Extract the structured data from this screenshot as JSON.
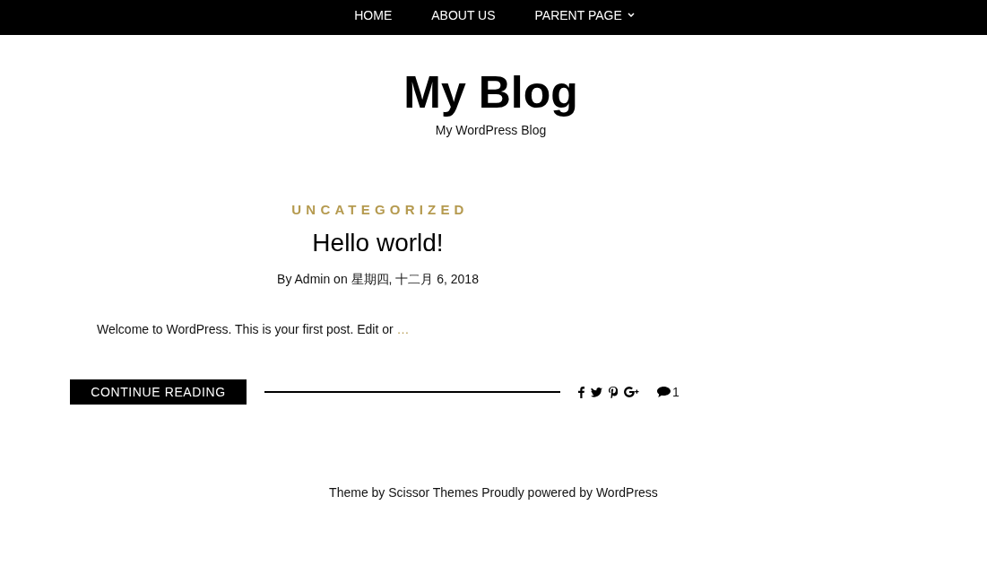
{
  "nav": [
    {
      "label": "HOME",
      "has_submenu": false
    },
    {
      "label": "ABOUT US",
      "has_submenu": false
    },
    {
      "label": "PARENT PAGE",
      "has_submenu": true
    }
  ],
  "site": {
    "title": "My Blog",
    "tagline": "My WordPress Blog"
  },
  "post": {
    "category": "UNCATEGORIZED",
    "title": "Hello world!",
    "byline": "By",
    "author": "Admin",
    "on": "on",
    "date": "星期四, 十二月 6, 2018",
    "excerpt": "Welcome to WordPress. This is your first post. Edit or",
    "more": "…",
    "button": "CONTINUE READING",
    "comment_count": "1"
  },
  "footer": {
    "theme_text": "Theme by",
    "theme_link": "Scissor Themes",
    "powered_text": "Proudly powered by",
    "powered_link": "WordPress"
  }
}
